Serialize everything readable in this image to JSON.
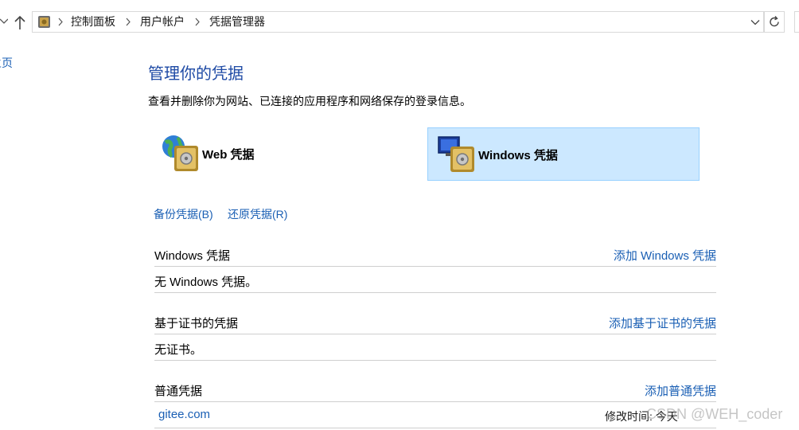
{
  "address_bar": {
    "breadcrumbs": [
      "控制面板",
      "用户帐户",
      "凭据管理器"
    ]
  },
  "left_pane": {
    "home_link": "主页"
  },
  "main": {
    "title": "管理你的凭据",
    "description": "查看并删除你为网站、已连接的应用程序和网络保存的登录信息。",
    "tiles": [
      {
        "label": "Web 凭据",
        "icon": "globe-vault-icon",
        "selected": false
      },
      {
        "label": "Windows 凭据",
        "icon": "computer-vault-icon",
        "selected": true
      }
    ],
    "actions": {
      "backup": "备份凭据(B)",
      "restore": "还原凭据(R)"
    },
    "sections": [
      {
        "title": "Windows 凭据",
        "add_label": "添加 Windows 凭据",
        "empty_text": "无 Windows 凭据。"
      },
      {
        "title": "基于证书的凭据",
        "add_label": "添加基于证书的凭据",
        "empty_text": "无证书。"
      },
      {
        "title": "普通凭据",
        "add_label": "添加普通凭据"
      }
    ],
    "generic_credentials": [
      {
        "name": "gitee.com",
        "modified": "修改时间: 今天"
      }
    ]
  },
  "watermark": "CSDN @WEH_coder",
  "colors": {
    "link": "#1a5fb4",
    "title": "#1e4aa5",
    "selected_tile_bg": "#cce8ff",
    "selected_tile_border": "#99d1ff"
  }
}
